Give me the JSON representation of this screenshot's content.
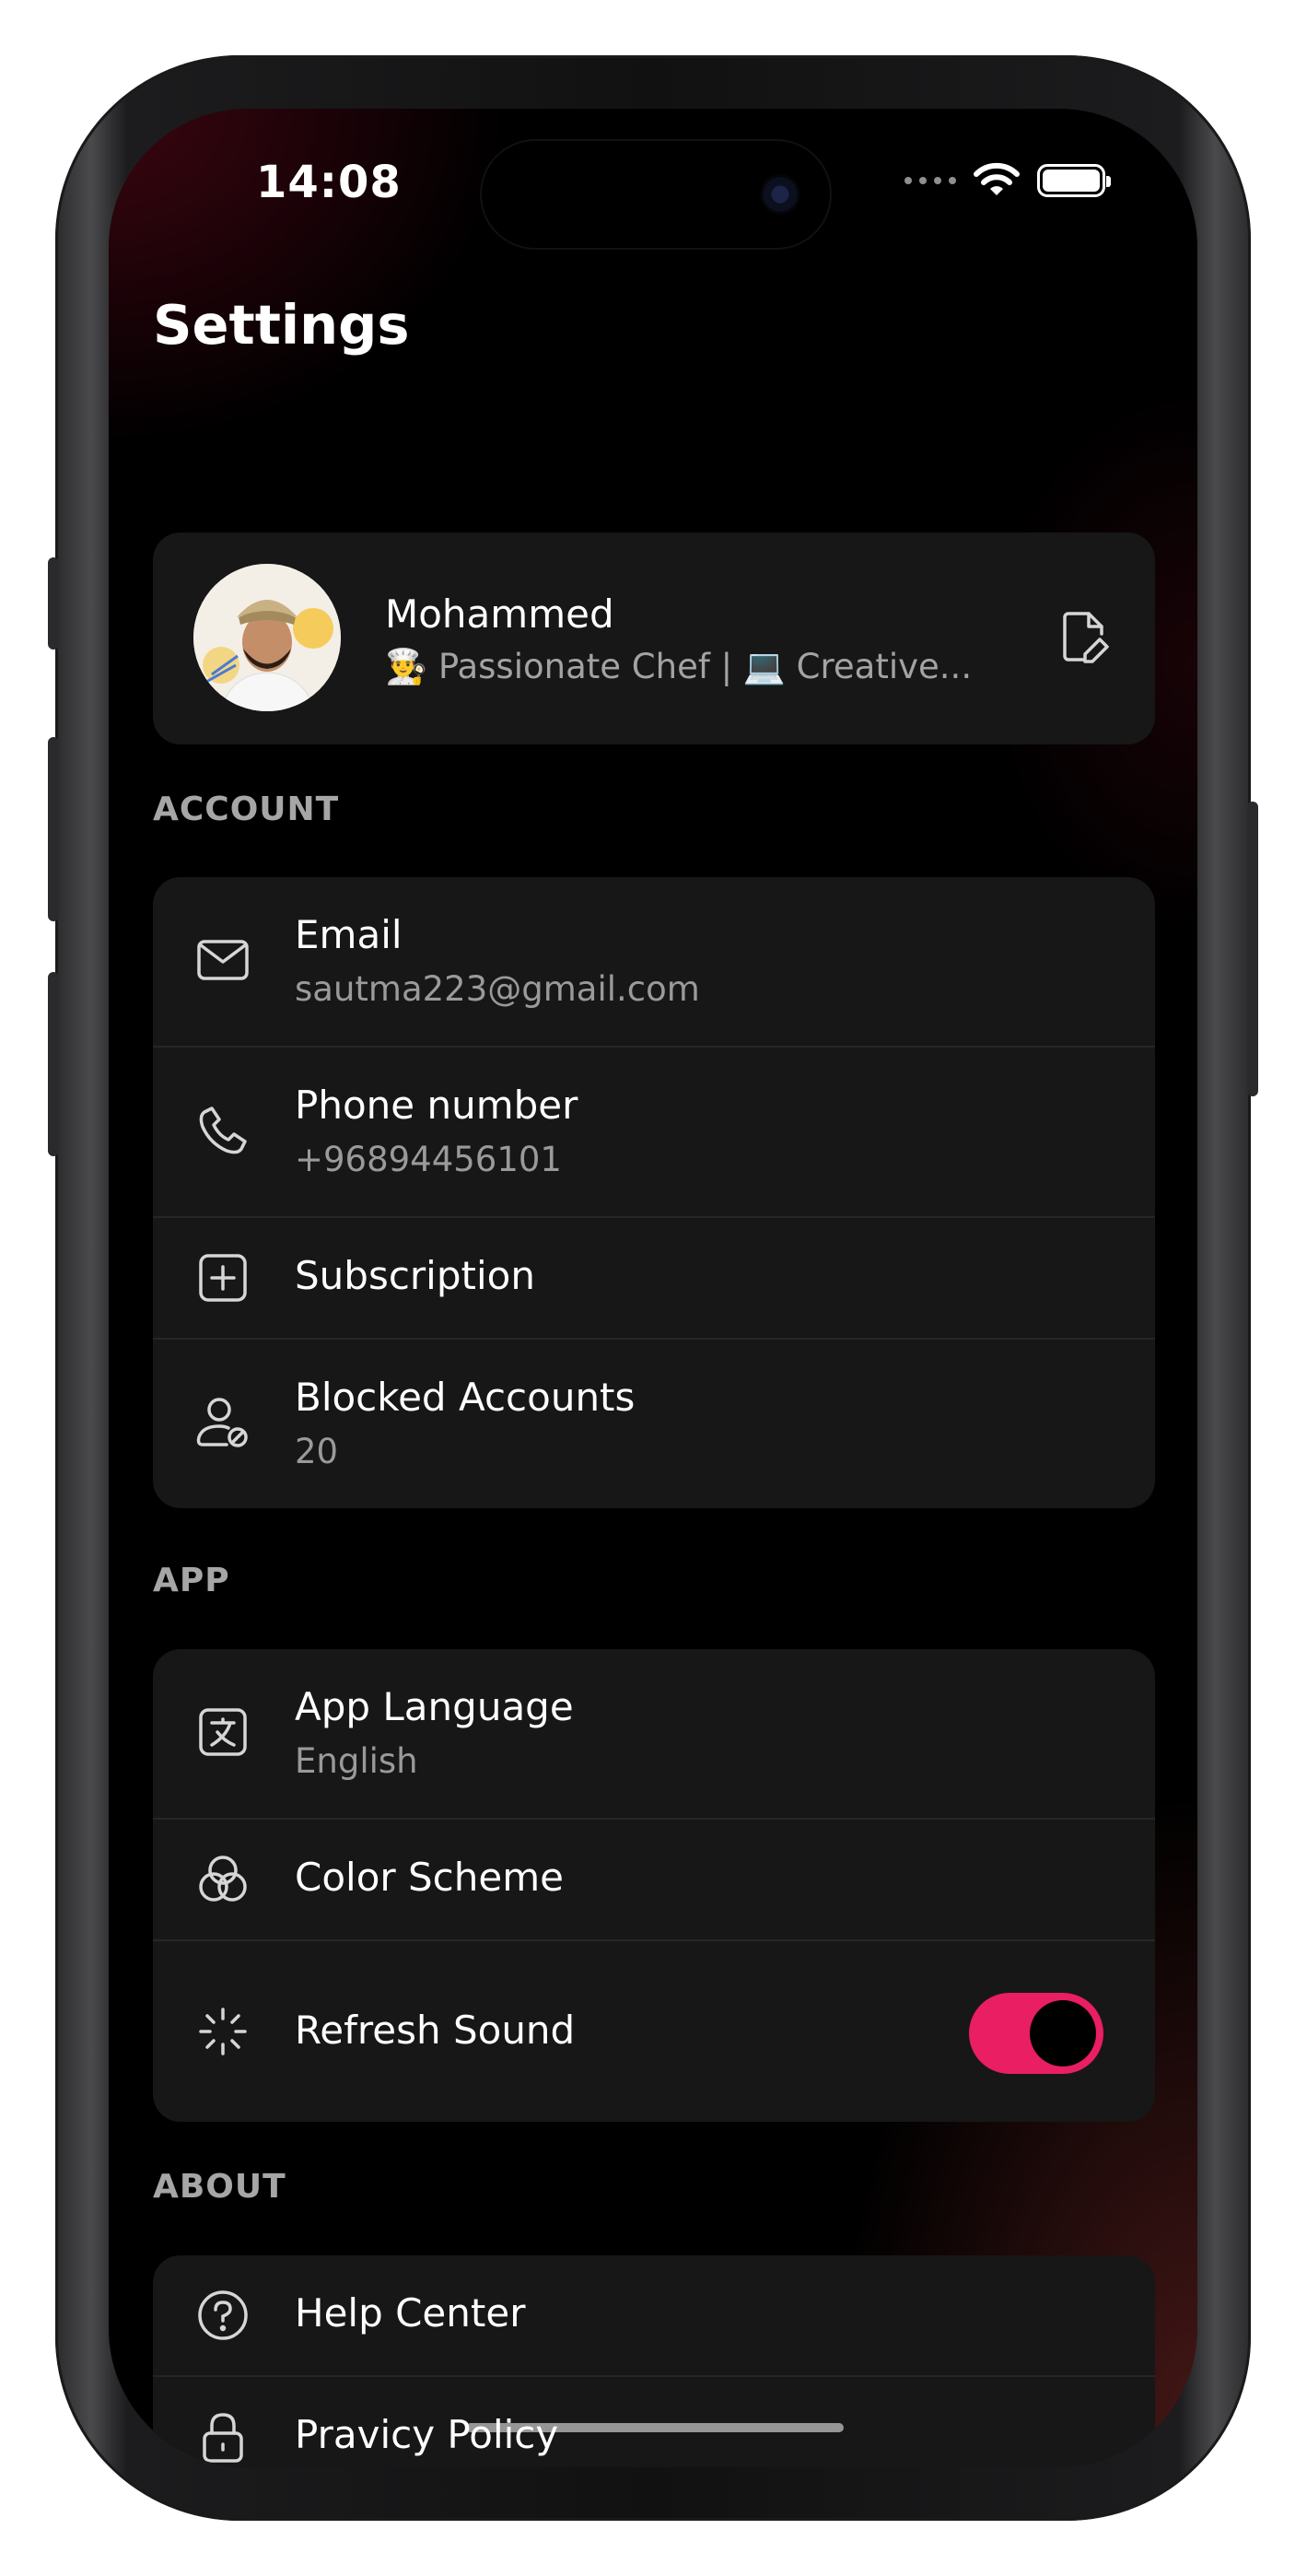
{
  "status_bar": {
    "time": "14:08"
  },
  "header": {
    "title": "Settings"
  },
  "profile": {
    "name": "Mohammed",
    "bio": "👨‍🍳 Passionate Chef | 💻 Creative..."
  },
  "sections": {
    "account": {
      "label": "ACCOUNT",
      "items": [
        {
          "title": "Email",
          "subtitle": "sautma223@gmail.com",
          "icon": "mail-icon"
        },
        {
          "title": "Phone number",
          "subtitle": "+96894456101",
          "icon": "phone-icon"
        },
        {
          "title": "Subscription",
          "icon": "plus-square-icon"
        },
        {
          "title": "Blocked Accounts",
          "subtitle": "20",
          "icon": "user-blocked-icon"
        }
      ]
    },
    "app": {
      "label": "APP",
      "items": [
        {
          "title": "App Language",
          "subtitle": "English",
          "icon": "translate-icon"
        },
        {
          "title": "Color Scheme",
          "icon": "color-circles-icon"
        },
        {
          "title": "Refresh Sound",
          "icon": "loader-icon",
          "toggle_on": true
        }
      ]
    },
    "about": {
      "label": "ABOUT",
      "items": [
        {
          "title": "Help Center",
          "icon": "help-circle-icon"
        },
        {
          "title": "Pravicy Policy",
          "icon": "lock-icon"
        }
      ]
    }
  },
  "colors": {
    "accent": "#e91e63",
    "card": "#171717",
    "background": "#000000"
  }
}
